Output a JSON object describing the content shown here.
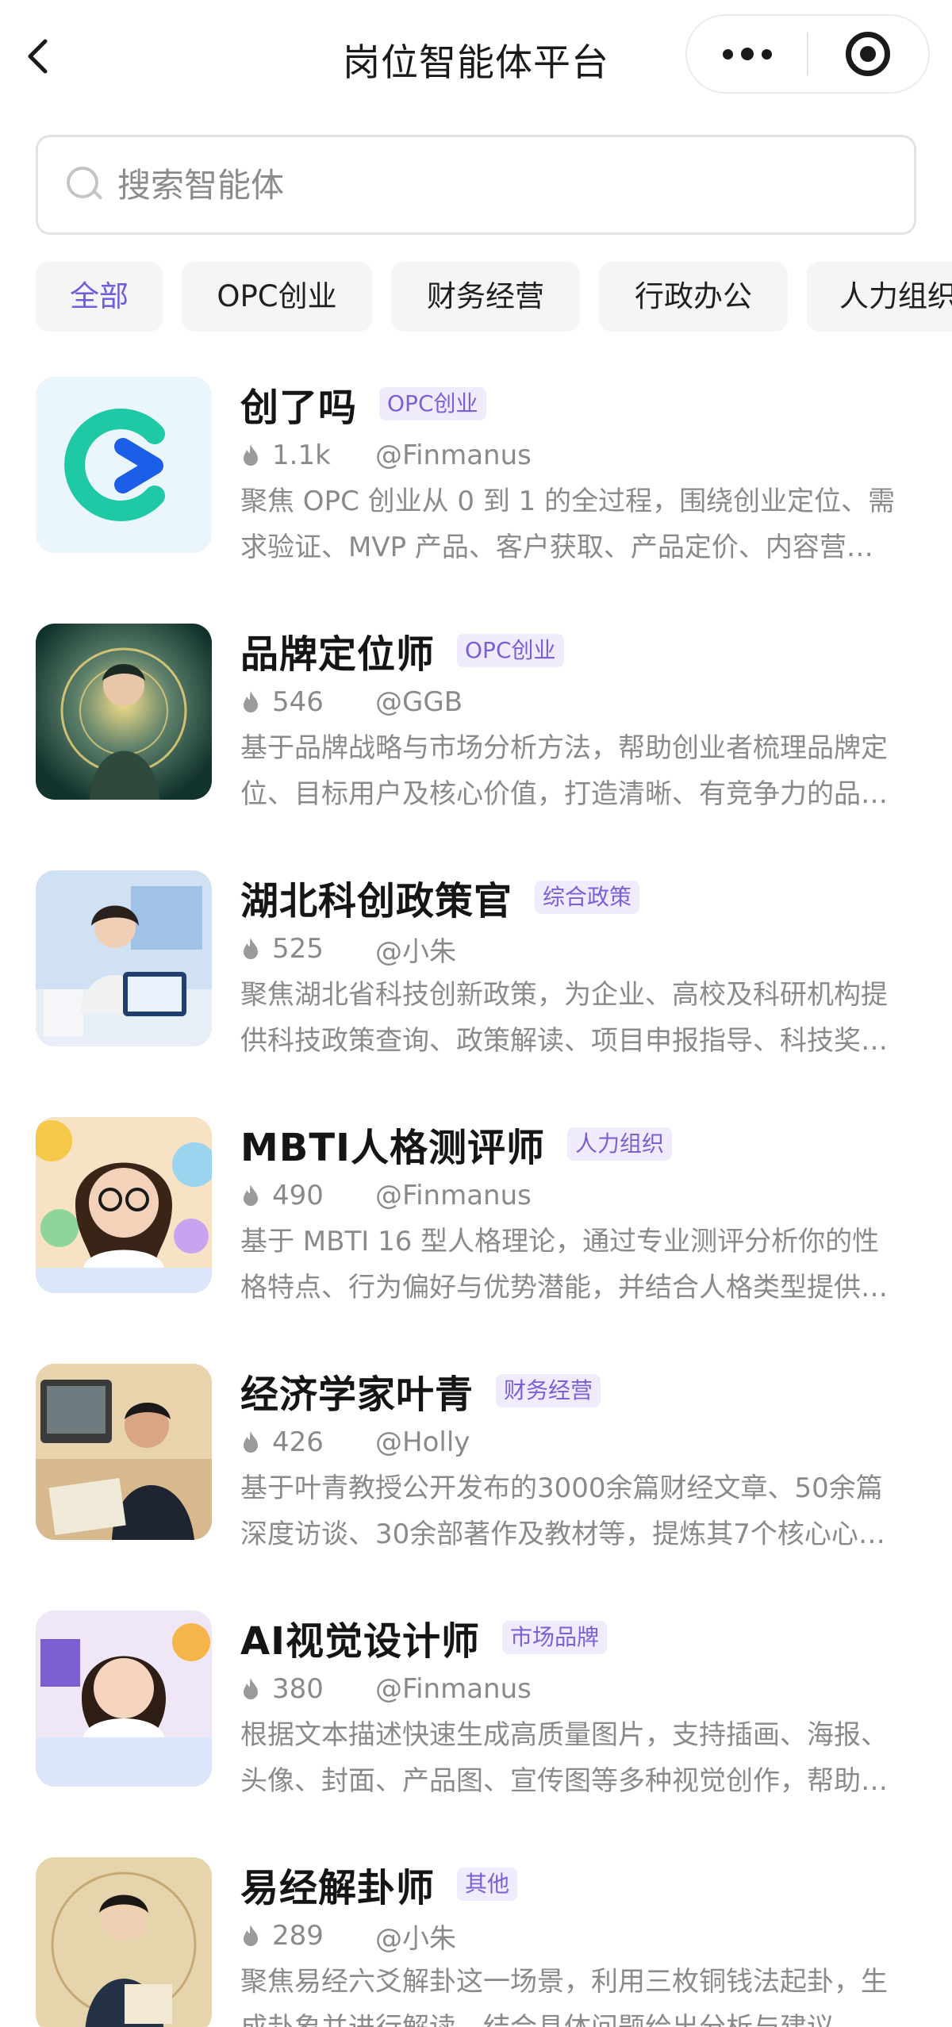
{
  "header": {
    "title": "岗位智能体平台",
    "back_icon": "chevron-left-icon",
    "more_icon": "more-dots-icon",
    "close_icon": "target-close-icon"
  },
  "search": {
    "placeholder": "搜索智能体",
    "value": ""
  },
  "tabs": [
    {
      "label": "全部",
      "active": true
    },
    {
      "label": "OPC创业",
      "active": false
    },
    {
      "label": "财务经营",
      "active": false
    },
    {
      "label": "行政办公",
      "active": false
    },
    {
      "label": "人力组织",
      "active": false
    }
  ],
  "colors": {
    "accent": "#6c5ce0",
    "tag_bg": "#f1ecfd",
    "muted_text": "#8a8a8a"
  },
  "agents": [
    {
      "name": "创了吗",
      "tag": "OPC创业",
      "count": "1.1k",
      "author": "@Finmanus",
      "desc_line1": "聚焦 OPC 创业从 0 到 1 的全过程，围绕创业定位、需",
      "desc_line2": "求验证、MVP 产品、客户获取、产品定价、内容营…"
    },
    {
      "name": "品牌定位师",
      "tag": "OPC创业",
      "count": "546",
      "author": "@GGB",
      "desc_line1": "基于品牌战略与市场分析方法，帮助创业者梳理品牌定",
      "desc_line2": "位、目标用户及核心价值，打造清晰、有竞争力的品…"
    },
    {
      "name": "湖北科创政策官",
      "tag": "综合政策",
      "count": "525",
      "author": "@小朱",
      "desc_line1": "聚焦湖北省科技创新政策，为企业、高校及科研机构提",
      "desc_line2": "供科技政策查询、政策解读、项目申报指导、科技奖…"
    },
    {
      "name": "MBTI人格测评师",
      "tag": "人力组织",
      "count": "490",
      "author": "@Finmanus",
      "desc_line1": "基于 MBTI 16 型人格理论，通过专业测评分析你的性",
      "desc_line2": "格特点、行为偏好与优势潜能，并结合人格类型提供…"
    },
    {
      "name": "经济学家叶青",
      "tag": "财务经营",
      "count": "426",
      "author": "@Holly",
      "desc_line1": "基于叶青教授公开发布的3000余篇财经文章、50余篇",
      "desc_line2": "深度访谈、30余部著作及教材等，提炼其7个核心心…"
    },
    {
      "name": "AI视觉设计师",
      "tag": "市场品牌",
      "count": "380",
      "author": "@Finmanus",
      "desc_line1": "根据文本描述快速生成高质量图片，支持插画、海报、",
      "desc_line2": "头像、封面、产品图、宣传图等多种视觉创作，帮助…"
    },
    {
      "name": "易经解卦师",
      "tag": "其他",
      "count": "289",
      "author": "@小朱",
      "desc_line1": "聚焦易经六爻解卦这一场景，利用三枚铜钱法起卦，生",
      "desc_line2": "成卦象并进行解读，结合具体问题给出分析与建议…"
    }
  ]
}
